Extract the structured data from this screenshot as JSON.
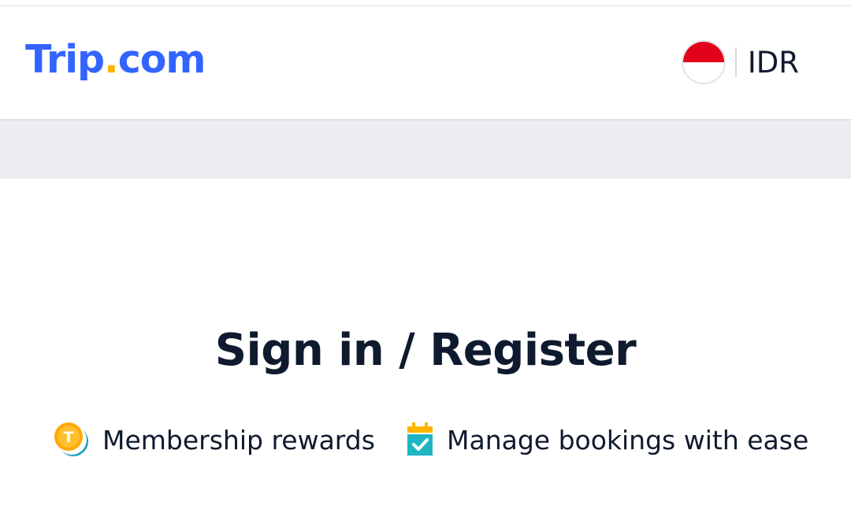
{
  "header": {
    "logo": {
      "part1": "Trip",
      "dot": ".",
      "part2": "com"
    },
    "currency": {
      "flag_icon": "indonesia-flag-icon",
      "code": "IDR"
    }
  },
  "main": {
    "title": "Sign in / Register",
    "benefits": [
      {
        "icon": "trip-coins-icon",
        "label": "Membership rewards"
      },
      {
        "icon": "calendar-check-icon",
        "label": "Manage bookings with ease"
      }
    ]
  },
  "colors": {
    "brand_blue": "#3264ff",
    "brand_yellow": "#ffb400",
    "text_dark": "#0f1a2e",
    "band_gray": "#ebedf1",
    "flag_red": "#e2001a"
  }
}
